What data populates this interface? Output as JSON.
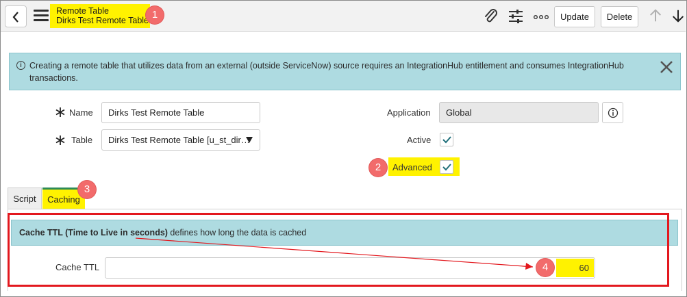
{
  "header": {
    "table_type": "Remote Table",
    "record_name": "Dirks Test Remote Table",
    "update_label": "Update",
    "delete_label": "Delete"
  },
  "info_banner": {
    "text": "Creating a remote table that utilizes data from an external (outside ServiceNow) source requires an IntegrationHub entitlement and consumes IntegrationHub transactions."
  },
  "form": {
    "name_label": "Name",
    "name_value": "Dirks Test Remote Table",
    "table_label": "Table",
    "table_value": "Dirks Test Remote Table [u_st_dir…",
    "application_label": "Application",
    "application_value": "Global",
    "active_label": "Active",
    "active_checked": true,
    "advanced_label": "Advanced",
    "advanced_checked": true
  },
  "tabs": [
    {
      "label": "Script",
      "selected": false
    },
    {
      "label": "Caching",
      "selected": true
    }
  ],
  "caching": {
    "banner_bold": "Cache TTL (Time to Live in seconds)",
    "banner_rest": " defines how long the data is cached",
    "ttl_label": "Cache TTL",
    "ttl_value": "60"
  },
  "callouts": [
    "1",
    "2",
    "3",
    "4"
  ],
  "colors": {
    "highlight": "#fff200",
    "callout": "#f26b6b",
    "banner": "#aedbe1",
    "annotation_red": "#e3181e",
    "check_teal": "#1f6f7a"
  }
}
